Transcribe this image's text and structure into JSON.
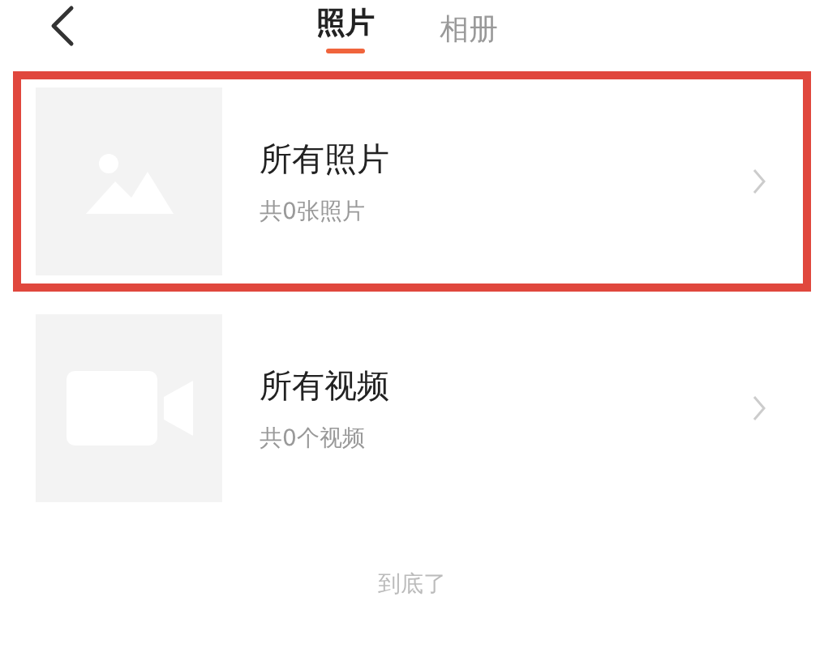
{
  "header": {
    "tabs": [
      {
        "label": "照片",
        "selected": true
      },
      {
        "label": "相册",
        "selected": false
      }
    ]
  },
  "albums": [
    {
      "kind": "photo",
      "title": "所有照片",
      "subtitle": "共0张照片",
      "highlighted": true
    },
    {
      "kind": "video",
      "title": "所有视频",
      "subtitle": "共0个视频",
      "highlighted": false
    }
  ],
  "footer": "到底了"
}
